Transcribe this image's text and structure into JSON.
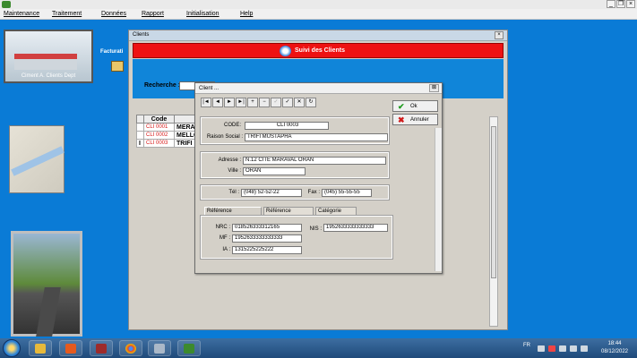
{
  "menubar": [
    "Maintenance",
    "Traitement",
    "Données",
    "Rapport",
    "Initialisation",
    "Help"
  ],
  "window_controls": {
    "minimize": "_",
    "restore": "❐",
    "close": "×"
  },
  "left": {
    "image_caption": "Ciment A. Clients Dept",
    "factu_label": "Facturati"
  },
  "clients_window": {
    "title": "Clients",
    "header_title": "Suivi des Clients",
    "search_label": "Recherche :",
    "search_value": "",
    "table": {
      "header": "Code",
      "rows": [
        {
          "code": "CLI 0001",
          "name": "MERAI"
        },
        {
          "code": "CLI 0002",
          "name": "MELLO"
        },
        {
          "code": "CLI 0003",
          "name": "TRIFI"
        }
      ],
      "row_marker": "I"
    }
  },
  "dialog": {
    "title": "Client ...",
    "nav_buttons": [
      "|◄",
      "◄",
      "►",
      "►|",
      "+",
      "−",
      "✓",
      "✓",
      "✕",
      "↻"
    ],
    "ok_label": "Ok",
    "cancel_label": "Annuler",
    "code_label": "CODE:",
    "code_value": "CLI 0003",
    "raison_label": "Raison Social :",
    "raison_value": "TRIFI MUSTAPHA",
    "adresse_label": "Adresse :",
    "adresse_value": "N.12 CITE MARAVAL ORAN",
    "ville_label": "Ville :",
    "ville_value": "ORAN",
    "tel_label": "Tél :",
    "tel_value": "(048) 52-52-22",
    "fax_label": "Fax :",
    "fax_value": "(045) 55-55-55",
    "tabs": [
      "Référence Commercial",
      "Référence Bancaire",
      "Catégorie Client"
    ],
    "nrc_label": "NRC :",
    "nrc_value": "018526333312165",
    "mf_label": "MF :",
    "mf_value": "1952633333333333",
    "ia_label": "IA :",
    "ia_value": "1315225225222",
    "nis_label": "NIS :",
    "nis_value": "1952633333333333"
  },
  "tray": {
    "lang": "FR",
    "time": "18:44",
    "date": "08/12/2022"
  },
  "colors": {
    "desktop_blue": "#0a7bd6",
    "header_red": "#ee1212",
    "code_red": "#d61818"
  }
}
